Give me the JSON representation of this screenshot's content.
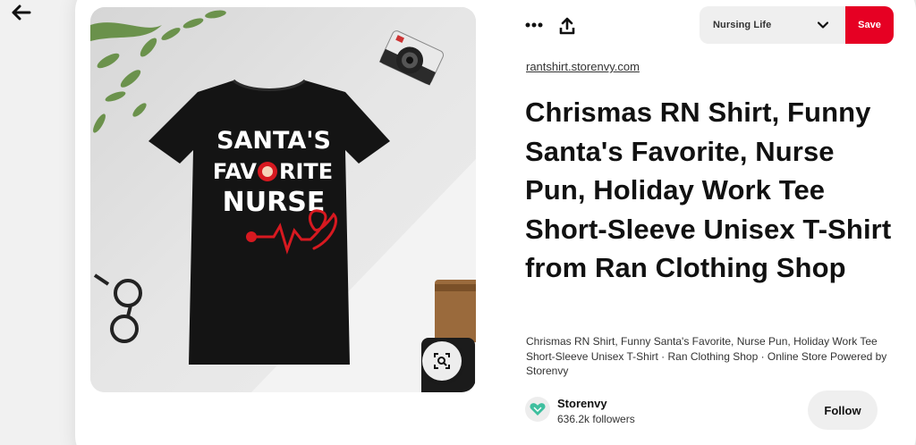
{
  "navigation": {
    "back_icon": "arrow-left-icon"
  },
  "pin": {
    "image_alt": "Black t-shirt printed with SANTA'S FAVORITE NURSE",
    "shirt_print": {
      "line1": "SANTA'S",
      "line2a": "FAV",
      "line2b": "RITE",
      "line3": "NURSE"
    },
    "lens_icon": "visual-search-icon",
    "source": "rantshirt.storenvy.com",
    "title": "Chrismas RN Shirt, Funny Santa's Favorite, Nurse Pun, Holiday Work Tee Short-Sleeve Unisex T-Shirt from Ran Clothing Shop",
    "description": "Chrismas RN Shirt, Funny Santa's Favorite, Nurse Pun, Holiday Work Tee Short-Sleeve Unisex T-Shirt · Ran Clothing Shop · Online Store Powered by Storenvy"
  },
  "actions": {
    "more_icon": "more-options-icon",
    "share_icon": "share-upload-icon",
    "board_select": "Nursing Life",
    "save_label": "Save"
  },
  "creator": {
    "name": "Storenvy",
    "followers": "636.2k followers",
    "follow_label": "Follow"
  },
  "colors": {
    "save": "#e60023",
    "chip": "#efefef",
    "accent_red": "#d71920"
  }
}
